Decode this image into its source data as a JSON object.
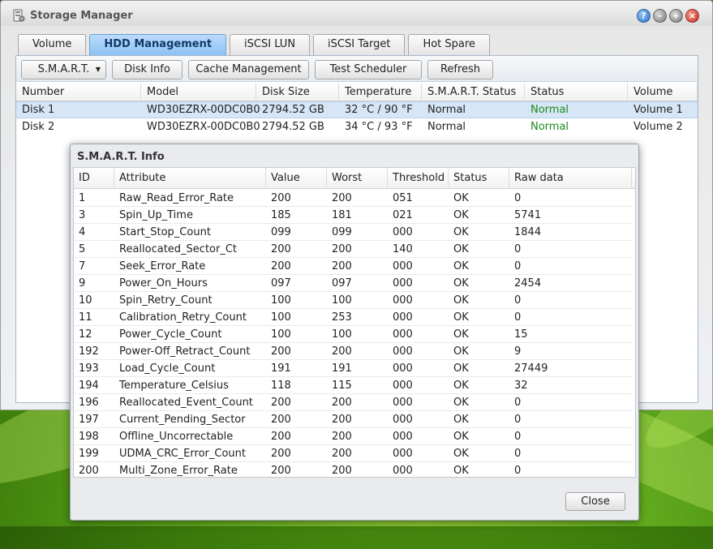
{
  "window": {
    "title": "Storage Manager"
  },
  "tabs": [
    {
      "label": "Volume",
      "active": false
    },
    {
      "label": "HDD Management",
      "active": true
    },
    {
      "label": "iSCSI LUN",
      "active": false
    },
    {
      "label": "iSCSI Target",
      "active": false
    },
    {
      "label": "Hot Spare",
      "active": false
    }
  ],
  "toolbar": {
    "smart_label": "S.M.A.R.T.",
    "disk_info_label": "Disk Info",
    "cache_label": "Cache Management",
    "test_scheduler_label": "Test Scheduler",
    "refresh_label": "Refresh"
  },
  "disk_grid": {
    "columns": [
      "Number",
      "Model",
      "Disk Size",
      "Temperature",
      "S.M.A.R.T. Status",
      "Status",
      "Volume"
    ],
    "rows": [
      [
        "Disk 1",
        "WD30EZRX-00DC0B0",
        "2794.52 GB",
        "32 °C / 90 °F",
        "Normal",
        "Normal",
        "Volume 1"
      ],
      [
        "Disk 2",
        "WD30EZRX-00DC0B0",
        "2794.52 GB",
        "34 °C / 93 °F",
        "Normal",
        "Normal",
        "Volume 2"
      ]
    ]
  },
  "smart_dialog": {
    "title": "S.M.A.R.T. Info",
    "columns": [
      "ID",
      "Attribute",
      "Value",
      "Worst",
      "Threshold",
      "Status",
      "Raw data"
    ],
    "rows": [
      [
        "1",
        "Raw_Read_Error_Rate",
        "200",
        "200",
        "051",
        "OK",
        "0"
      ],
      [
        "3",
        "Spin_Up_Time",
        "185",
        "181",
        "021",
        "OK",
        "5741"
      ],
      [
        "4",
        "Start_Stop_Count",
        "099",
        "099",
        "000",
        "OK",
        "1844"
      ],
      [
        "5",
        "Reallocated_Sector_Ct",
        "200",
        "200",
        "140",
        "OK",
        "0"
      ],
      [
        "7",
        "Seek_Error_Rate",
        "200",
        "200",
        "000",
        "OK",
        "0"
      ],
      [
        "9",
        "Power_On_Hours",
        "097",
        "097",
        "000",
        "OK",
        "2454"
      ],
      [
        "10",
        "Spin_Retry_Count",
        "100",
        "100",
        "000",
        "OK",
        "0"
      ],
      [
        "11",
        "Calibration_Retry_Count",
        "100",
        "253",
        "000",
        "OK",
        "0"
      ],
      [
        "12",
        "Power_Cycle_Count",
        "100",
        "100",
        "000",
        "OK",
        "15"
      ],
      [
        "192",
        "Power-Off_Retract_Count",
        "200",
        "200",
        "000",
        "OK",
        "9"
      ],
      [
        "193",
        "Load_Cycle_Count",
        "191",
        "191",
        "000",
        "OK",
        "27449"
      ],
      [
        "194",
        "Temperature_Celsius",
        "118",
        "115",
        "000",
        "OK",
        "32"
      ],
      [
        "196",
        "Reallocated_Event_Count",
        "200",
        "200",
        "000",
        "OK",
        "0"
      ],
      [
        "197",
        "Current_Pending_Sector",
        "200",
        "200",
        "000",
        "OK",
        "0"
      ],
      [
        "198",
        "Offline_Uncorrectable",
        "200",
        "200",
        "000",
        "OK",
        "0"
      ],
      [
        "199",
        "UDMA_CRC_Error_Count",
        "200",
        "200",
        "000",
        "OK",
        "0"
      ],
      [
        "200",
        "Multi_Zone_Error_Rate",
        "200",
        "200",
        "000",
        "OK",
        "0"
      ]
    ],
    "close_label": "Close"
  },
  "colors": {
    "accent": "#8cc2f3",
    "status_ok": "#1a8a1a"
  },
  "icons": {
    "app": "storage-manager-icon",
    "help": "help-icon",
    "minimize": "minimize-icon",
    "maximize": "maximize-icon",
    "close": "close-icon"
  }
}
